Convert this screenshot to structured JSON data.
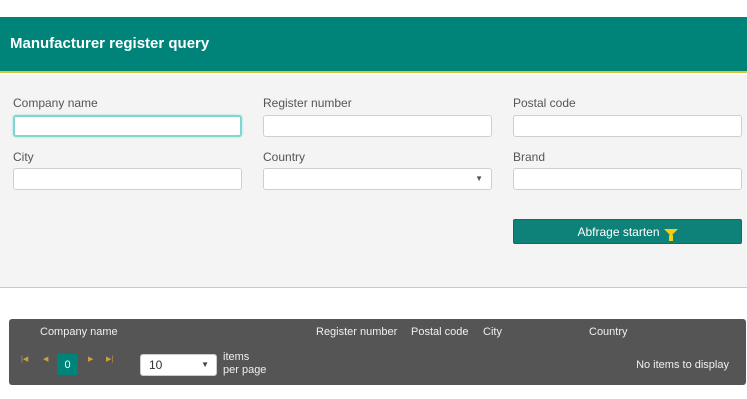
{
  "window": {
    "crumb": ""
  },
  "header": {
    "title": "Manufacturer register query"
  },
  "form": {
    "company_name": {
      "label": "Company name",
      "value": ""
    },
    "register_number": {
      "label": "Register number",
      "value": ""
    },
    "postal_code": {
      "label": "Postal code",
      "value": ""
    },
    "city": {
      "label": "City",
      "value": ""
    },
    "country": {
      "label": "Country",
      "value": ""
    },
    "brand": {
      "label": "Brand",
      "value": ""
    },
    "query_button": {
      "label": "Abfrage starten",
      "icon": "filter-icon"
    }
  },
  "grid": {
    "columns": [
      "Company name",
      "Register number",
      "Postal code",
      "City",
      "Country"
    ],
    "rows": [],
    "pager": {
      "current_page": "0",
      "page_size": "10",
      "items_per_page_line1": "items",
      "items_per_page_line2": "per page",
      "status": "No items to display"
    }
  },
  "colors": {
    "accent": "#00847a",
    "highlight": "#d7c63a",
    "grid_bg": "#555555",
    "filter_icon": "#f6d00e"
  }
}
